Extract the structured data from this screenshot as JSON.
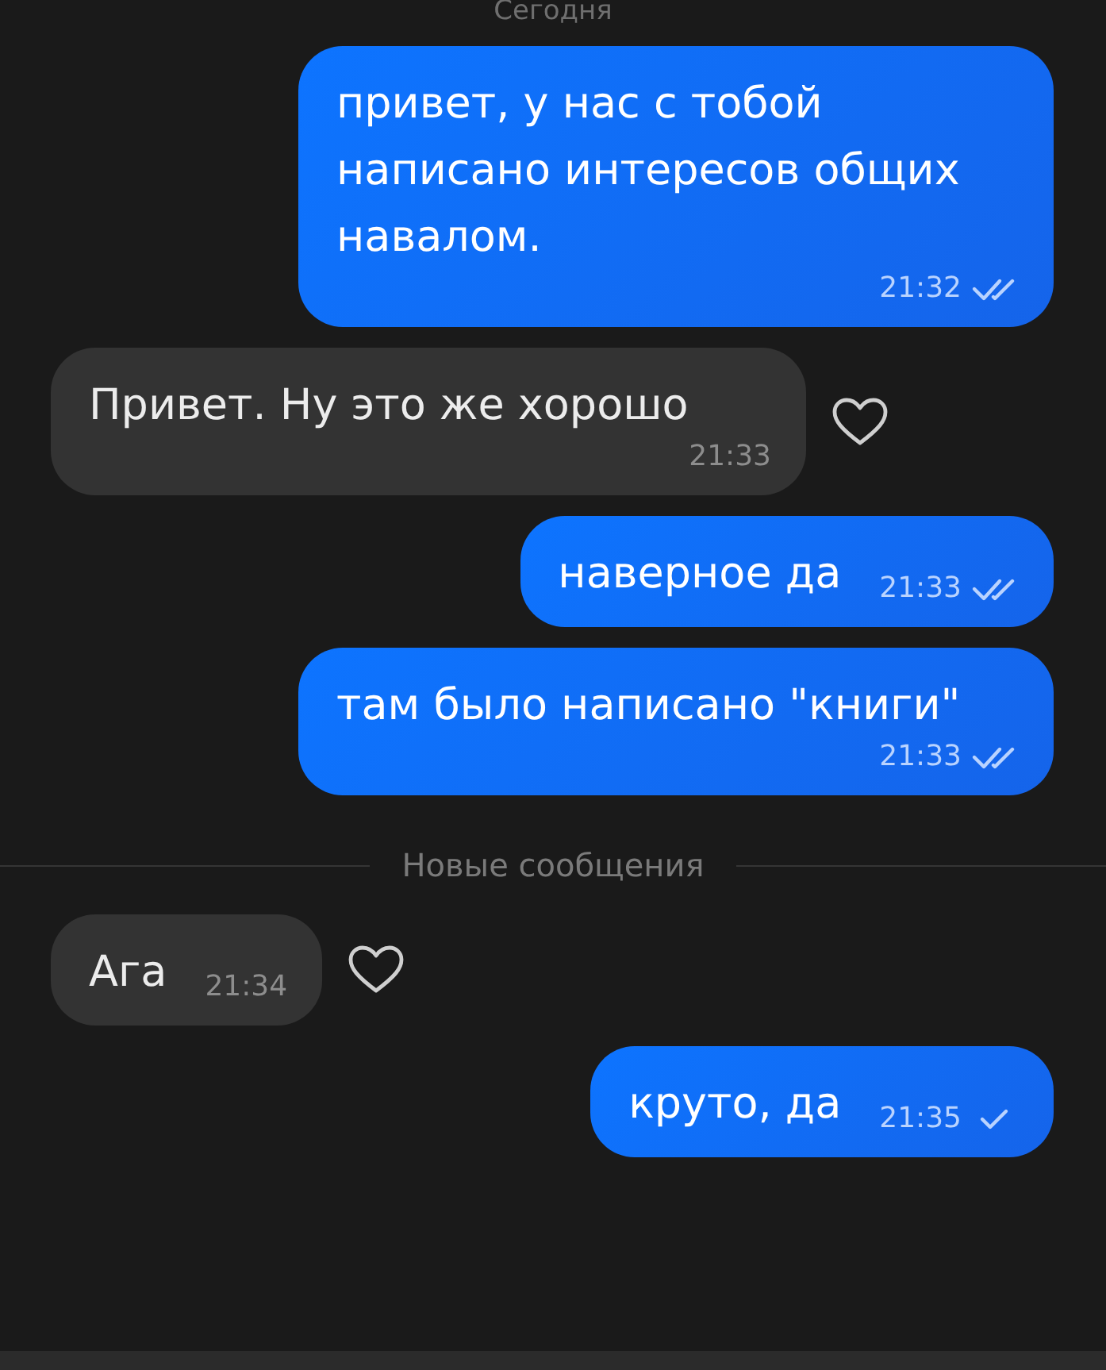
{
  "date_header": "Сегодня",
  "messages_before": [
    {
      "kind": "out",
      "text": "привет, у нас с тобой написано интересов общих навалом.",
      "time": "21:32",
      "read": true
    },
    {
      "kind": "in",
      "text": "Привет. Ну это же хорошо",
      "time": "21:33",
      "liked": false
    },
    {
      "kind": "out",
      "text": "наверное да",
      "time": "21:33",
      "read": true
    },
    {
      "kind": "out",
      "text": "там было написано \"книги\"",
      "time": "21:33",
      "read": true
    }
  ],
  "new_divider": "Новые сообщения",
  "messages_after": [
    {
      "kind": "in",
      "text": "Ага",
      "time": "21:34",
      "liked": false
    },
    {
      "kind": "out",
      "text": "круто, да",
      "time": "21:35",
      "read": false
    }
  ]
}
